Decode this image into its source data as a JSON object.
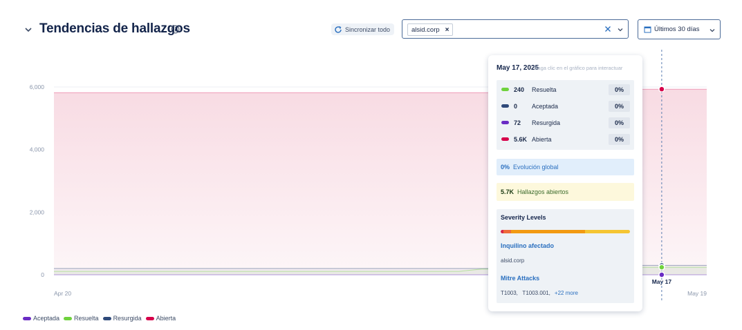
{
  "header": {
    "title": "Tendencias de hallazgos",
    "sync_label": "Sincronizar todo",
    "filter_chip": "alsid.corp",
    "chip_remove": "×",
    "date_range": "Últimos 30 días"
  },
  "tooltip": {
    "date": "May 17, 2025",
    "hint": "Haga clic en el gráfico para interactuar",
    "rows": [
      {
        "value": "240",
        "name": "Resuelta",
        "pct": "0%",
        "color": "#6fd23d"
      },
      {
        "value": "0",
        "name": "Aceptada",
        "pct": "0%",
        "color": "#2f4a7a"
      },
      {
        "value": "72",
        "name": "Resurgida",
        "pct": "0%",
        "color": "#6a2cc4"
      },
      {
        "value": "5.6K",
        "name": "Abierta",
        "pct": "0%",
        "color": "#d6004a"
      }
    ],
    "global_value": "0%",
    "global_label": "Evolución global",
    "open_value": "5.7K",
    "open_label": "Hallazgos abiertos",
    "severity_title": "Severity Levels",
    "severity_segments": [
      {
        "fraction": 0.02,
        "color": "#d6264a"
      },
      {
        "fraction": 0.06,
        "color": "#ee6a3a"
      },
      {
        "fraction": 0.57,
        "color": "#f29a12"
      },
      {
        "fraction": 0.35,
        "color": "#f5c532"
      }
    ],
    "tenant_title": "Inquilino afectado",
    "tenant_value": "alsid.corp",
    "mitre_title": "Mitre Attacks",
    "mitre_value": "T1003,   T1003.001,",
    "mitre_more": "+22 more"
  },
  "legend": [
    {
      "label": "Aceptada",
      "color": "#6a2cc4"
    },
    {
      "label": "Resuelta",
      "color": "#6fd23d"
    },
    {
      "label": "Resurgida",
      "color": "#2f4a7a"
    },
    {
      "label": "Abierta",
      "color": "#d6004a"
    }
  ],
  "chart_data": {
    "type": "area",
    "ylim": [
      0,
      6000
    ],
    "yticks": [
      "0",
      "2,000",
      "4,000",
      "6,000"
    ],
    "xticks": [
      "Apr 20",
      "May 17",
      "May 19"
    ],
    "x": [
      "Apr 20",
      "Apr 21",
      "Apr 22",
      "Apr 23",
      "Apr 24",
      "Apr 25",
      "Apr 26",
      "Apr 27",
      "Apr 28",
      "Apr 29",
      "Apr 30",
      "May 1",
      "May 2",
      "May 3",
      "May 4",
      "May 5",
      "May 6",
      "May 7",
      "May 8",
      "May 9",
      "May 10",
      "May 11",
      "May 12",
      "May 13",
      "May 14",
      "May 15",
      "May 16",
      "May 17",
      "May 18",
      "May 19"
    ],
    "highlight_x": "May 17",
    "series": [
      {
        "name": "Abierta",
        "color": "#d6004a",
        "values": [
          5820,
          5820,
          5820,
          5820,
          5820,
          5820,
          5820,
          5820,
          5820,
          5820,
          5820,
          5820,
          5820,
          5820,
          5820,
          5820,
          5820,
          5820,
          5820,
          5820,
          5820,
          5820,
          5820,
          5820,
          5820,
          5930,
          5930,
          5930,
          5930,
          5930
        ]
      },
      {
        "name": "Resurgida",
        "color": "#2f4a7a",
        "values": [
          200,
          200,
          200,
          200,
          200,
          200,
          200,
          200,
          200,
          200,
          200,
          200,
          200,
          200,
          200,
          200,
          200,
          200,
          200,
          200,
          200,
          200,
          200,
          300,
          300,
          300,
          300,
          300,
          300,
          300
        ]
      },
      {
        "name": "Resuelta",
        "color": "#6fd23d",
        "values": [
          110,
          110,
          110,
          110,
          110,
          110,
          110,
          110,
          110,
          110,
          110,
          110,
          110,
          110,
          110,
          110,
          110,
          110,
          110,
          180,
          180,
          180,
          180,
          240,
          240,
          240,
          240,
          240,
          240,
          240
        ]
      },
      {
        "name": "Aceptada",
        "color": "#6a2cc4",
        "values": [
          0,
          0,
          0,
          0,
          0,
          0,
          0,
          0,
          0,
          0,
          0,
          0,
          0,
          0,
          0,
          0,
          0,
          0,
          0,
          0,
          0,
          0,
          0,
          0,
          0,
          0,
          0,
          0,
          0,
          0
        ]
      }
    ]
  }
}
